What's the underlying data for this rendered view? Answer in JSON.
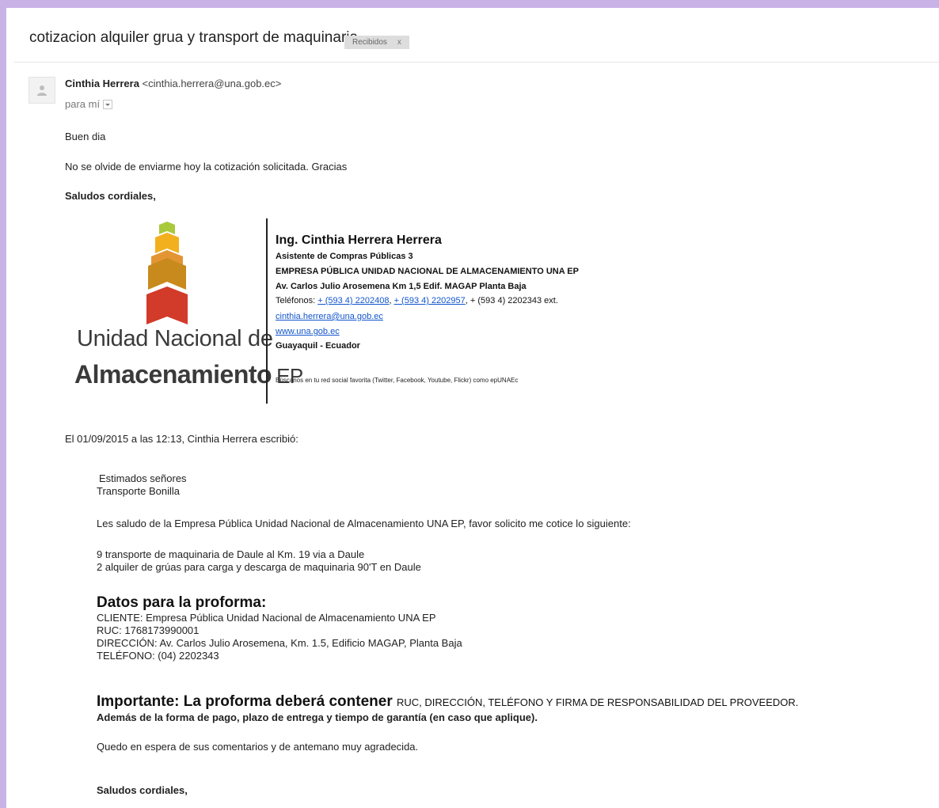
{
  "colors": {
    "frame": "#c9b3e6",
    "link": "#1155cc",
    "logo_stack": [
      "#a8c93b",
      "#f2b01e",
      "#e08a1e",
      "#c88a1c",
      "#d23a2a"
    ]
  },
  "email": {
    "subject": "cotizacion alquiler grua y transport de maquinaria",
    "label": "Recibidos",
    "label_close": "x",
    "sender_name": "Cinthia Herrera",
    "sender_email": "<cinthia.herrera@una.gob.ec>",
    "to": "para mí",
    "avatar_icon": "person-icon",
    "dropdown_icon": "chevron-down-icon"
  },
  "body": {
    "greeting": "Buen dia",
    "line1": "No se olvide de enviarme hoy la cotización solicitada. Gracias",
    "closing": "Saludos cordiales,"
  },
  "signature": {
    "logo_line1": "Unidad Nacional de",
    "logo_line2": "Almacenamiento",
    "logo_ep": "EP",
    "name": "Ing. Cinthia Herrera Herrera",
    "title": "Asistente de Compras Públicas 3",
    "company": "EMPRESA PÚBLICA UNIDAD NACIONAL DE ALMACENAMIENTO UNA EP",
    "address": "Av. Carlos Julio Arosemena Km 1,5 Edif. MAGAP Planta Baja",
    "phones_label": "Teléfonos:",
    "phone1": "+ (593 4) 2202408",
    "phone2": "+ (593 4) 2202957",
    "phone3": "+ (593 4) 2202343 ext.",
    "email": "cinthia.herrera@una.gob.ec",
    "web": "www.una.gob.ec",
    "city": "Guayaquil - Ecuador",
    "social": "Búscanos en tu red social favorita (Twitter, Facebook, Youtube, Flickr) como epUNAEc"
  },
  "quoted": {
    "header": "El 01/09/2015 a las 12:13, Cinthia Herrera escribió:",
    "salutation1": "Estimados señores",
    "salutation2": "Transporte Bonilla",
    "intro": "Les saludo de la Empresa Pública Unidad Nacional de Almacenamiento UNA EP, favor solicito me cotice lo siguiente:",
    "item1": "9 transporte de maquinaria de Daule al Km. 19 via a Daule",
    "item2": "2 alquiler de grúas para carga y descarga de maquinaria 90'T en Daule",
    "datos_heading": "Datos para la proforma:",
    "cliente": "CLIENTE: Empresa Pública Unidad Nacional de Almacenamiento UNA EP",
    "ruc": "RUC: 1768173990001",
    "direccion": "DIRECCIÓN: Av. Carlos Julio Arosemena, Km. 1.5, Edificio MAGAP, Planta Baja",
    "telefono": "TELÉFONO: (04) 2202343",
    "important_heading": "Importante: La proforma deberá contener",
    "important_rest": "RUC, DIRECCIÓN, TELÉFONO Y FIRMA DE RESPONSABILIDAD DEL PROVEEDOR.",
    "important_line2": "Además de la forma de pago, plazo de entrega y tiempo de garantía (en caso que aplique).",
    "waiting": "Quedo en espera de sus comentarios y de antemano muy agradecida.",
    "closing": "Saludos cordiales,"
  }
}
